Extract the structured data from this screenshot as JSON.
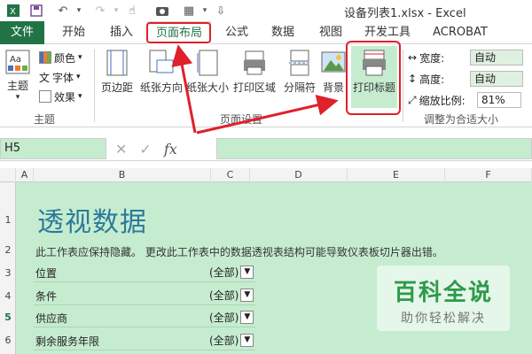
{
  "window": {
    "title": "设备列表1.xlsx - Excel"
  },
  "tabs": [
    {
      "label": "文件"
    },
    {
      "label": "开始"
    },
    {
      "label": "插入"
    },
    {
      "label": "页面布局"
    },
    {
      "label": "公式"
    },
    {
      "label": "数据"
    },
    {
      "label": "视图"
    },
    {
      "label": "开发工具"
    },
    {
      "label": "ACROBAT"
    }
  ],
  "ribbon": {
    "theme": {
      "label": "主题",
      "colors": "颜色",
      "fonts": "字体",
      "effects": "效果",
      "group": "主题"
    },
    "page_setup": {
      "margins": "页边距",
      "orientation": "纸张方向",
      "size": "纸张大小",
      "print_area": "打印区域",
      "breaks": "分隔符",
      "background": "背景",
      "print_titles": "打印标题",
      "group": "页面设置"
    },
    "scale": {
      "width_label": "宽度:",
      "width_value": "自动",
      "height_label": "高度:",
      "height_value": "自动",
      "scale_label": "缩放比例:",
      "scale_value": "81%",
      "group": "调整为合适大小"
    }
  },
  "formula_bar": {
    "name_box": "H5",
    "fx": "fx",
    "content": ""
  },
  "columns": [
    "A",
    "B",
    "C",
    "D",
    "E",
    "F"
  ],
  "rows": [
    "1",
    "2",
    "3",
    "4",
    "5",
    "6"
  ],
  "sheet": {
    "heading": "透视数据",
    "note": "此工作表应保持隐藏。 更改此工作表中的数据透视表结构可能导致仪表板切片器出错。",
    "fields": [
      {
        "label": "位置",
        "value": "(全部)"
      },
      {
        "label": "条件",
        "value": "(全部)"
      },
      {
        "label": "供应商",
        "value": "(全部)"
      },
      {
        "label": "剩余服务年限",
        "value": "(全部)"
      }
    ]
  },
  "watermark": {
    "main": "百科全说",
    "sub": "助你轻松解决"
  },
  "colors": {
    "excel_green": "#217346",
    "sheet_bg": "#c6ecd0",
    "highlight_red": "#e0202a",
    "heading_blue": "#2b7a9a"
  }
}
